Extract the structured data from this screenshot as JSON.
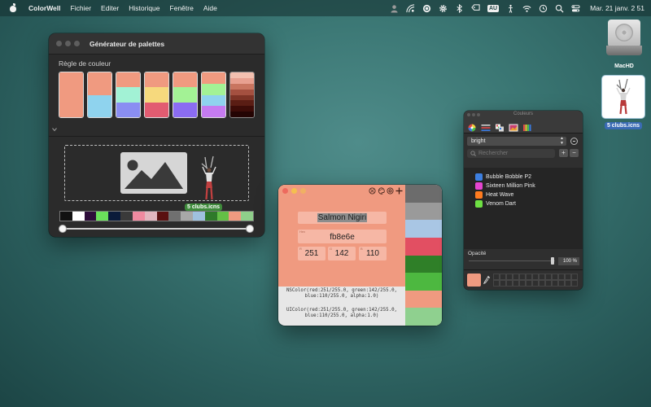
{
  "menubar": {
    "app_name": "ColorWell",
    "items": [
      "Fichier",
      "Editer",
      "Historique",
      "Fenêtre",
      "Aide"
    ],
    "input_badge": "AU",
    "clock": "Mar. 21 janv.   2 51"
  },
  "desktop": {
    "disk_label": "MacHD",
    "file_label": "5 clubs.icns"
  },
  "palette_window": {
    "title": "Générateur de palettes",
    "rule_label": "Règle de couleur",
    "drag_label": "5 clubs.icns",
    "palettes": [
      [
        "#f09a80"
      ],
      [
        "#f09a80",
        "#8fd3ee"
      ],
      [
        "#f09a80",
        "#a2f2d5",
        "#8a8ef2"
      ],
      [
        "#f09a80",
        "#f6d97d",
        "#e25c71"
      ],
      [
        "#f09a80",
        "#a3f295",
        "#8b6cf2"
      ],
      [
        "#f09a80",
        "#a3f295",
        "#8fd3ee",
        "#c57bf0"
      ],
      [
        "#f3c0b0",
        "#e8a090",
        "#c97560",
        "#a45040",
        "#7d3326",
        "#5a1d14",
        "#3d0c08",
        "#240403"
      ]
    ],
    "strip_colors": [
      "#111111",
      "#ffffff",
      "#2d0d3a",
      "#6ae05b",
      "#0b1b3a",
      "#3a3a3a",
      "#f08aa0",
      "#e2b6bf",
      "#5a1010",
      "#707070",
      "#a8a8a8",
      "#9fc1de",
      "#2f7a2a",
      "#64c046",
      "#f09a80",
      "#8fcf8a"
    ]
  },
  "color_window": {
    "color_name": "Salmon Nigiri",
    "hex_hint": "Hex",
    "hex_value": "fb8e6e",
    "rgb": [
      {
        "hint": "R",
        "value": "251"
      },
      {
        "hint": "G",
        "value": "142"
      },
      {
        "hint": "B",
        "value": "110"
      }
    ],
    "nscolor_line1": "NSColor(red:251/255.0, green:142/255.0,",
    "nscolor_line2": "blue:110/255.0, alpha:1.0)",
    "uicolor_line1": "UIColor(red:251/255.0, green:142/255.0,",
    "uicolor_line2": "blue:110/255.0, alpha:1.0)",
    "swatch_colors": [
      "#6c6c6c",
      "#9a9a9a",
      "#a9c6e4",
      "#e24f62",
      "#2f7f28",
      "#4db840",
      "#f09a80",
      "#8fd08f"
    ]
  },
  "colors_panel": {
    "title": "Couleurs",
    "palette_selected": "bright",
    "search_placeholder": "Rechercher",
    "add_label": "+",
    "remove_label": "−",
    "list": [
      {
        "name": "Bubble Bobble P2",
        "color": "#3d7fe0"
      },
      {
        "name": "Sixteen Million Pink",
        "color": "#e545d0"
      },
      {
        "name": "Heat Wave",
        "color": "#ff7b1f"
      },
      {
        "name": "Venom Dart",
        "color": "#6ee043"
      }
    ],
    "opacity_label": "Opacité",
    "opacity_value": "100 %",
    "current_color": "#f09a80"
  }
}
